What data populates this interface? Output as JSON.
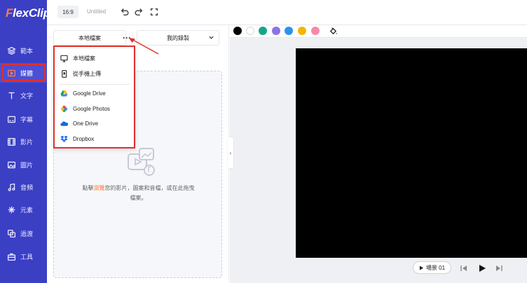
{
  "app": {
    "logo_main": "lexClip",
    "logo_accent": "F"
  },
  "sidebar": {
    "items": [
      {
        "label": "範本",
        "icon": "layers-icon"
      },
      {
        "label": "媒體",
        "icon": "media-folder-icon"
      },
      {
        "label": "文字",
        "icon": "text-icon"
      },
      {
        "label": "字幕",
        "icon": "subtitle-icon"
      },
      {
        "label": "影片",
        "icon": "video-icon"
      },
      {
        "label": "圖片",
        "icon": "image-icon"
      },
      {
        "label": "音頻",
        "icon": "music-icon"
      },
      {
        "label": "元素",
        "icon": "elements-icon"
      },
      {
        "label": "過渡",
        "icon": "transition-icon"
      },
      {
        "label": "工具",
        "icon": "tools-icon"
      }
    ],
    "active_index": 1
  },
  "toolbar": {
    "ratio": "16:9",
    "title": "Untitled",
    "icons": [
      "undo-icon",
      "redo-icon",
      "fullscreen-icon"
    ]
  },
  "panel": {
    "tab_local": "本地檔案",
    "more": "···",
    "tab_mine": "我的錄製",
    "upload_text_before": "點擊",
    "upload_text_link": "瀏覽",
    "upload_text_after": "您的影片，圖案和音檔，或在此拖曳檔案。"
  },
  "menu": {
    "items": [
      {
        "label": "本地檔案",
        "icon": "monitor-icon"
      },
      {
        "label": "從手機上傳",
        "icon": "phone-icon"
      },
      {
        "label": "Google Drive",
        "icon": "google-drive-icon"
      },
      {
        "label": "Google Photos",
        "icon": "google-photos-icon"
      },
      {
        "label": "One Drive",
        "icon": "onedrive-icon"
      },
      {
        "label": "Dropbox",
        "icon": "dropbox-icon"
      }
    ]
  },
  "colors": {
    "swatches": [
      "#000000",
      "#ffffff",
      "#19a58a",
      "#8b74e4",
      "#2a94ea",
      "#f5b500",
      "#f48aa9"
    ],
    "sidebar_bg": "#3b3fc4",
    "accent": "#ff7a45",
    "highlight_border": "#e0302b"
  },
  "player": {
    "scene_label": "場景 01"
  }
}
